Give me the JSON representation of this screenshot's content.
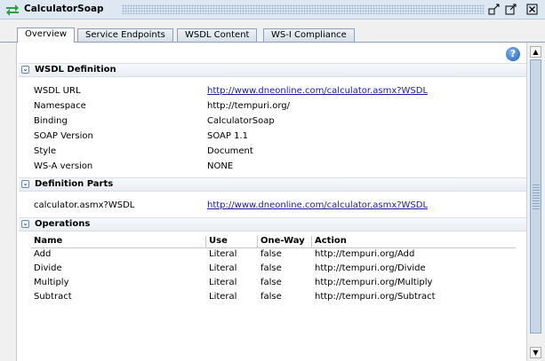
{
  "window": {
    "title": "CalculatorSoap"
  },
  "tabs": [
    "Overview",
    "Service Endpoints",
    "WSDL Content",
    "WS-I Compliance"
  ],
  "help_icon": "?",
  "sections": {
    "wsdl_definition": {
      "title": "WSDL Definition",
      "rows": [
        {
          "label": "WSDL URL",
          "value": "http://www.dneonline.com/calculator.asmx?WSDL"
        },
        {
          "label": "Namespace",
          "value": "http://tempuri.org/"
        },
        {
          "label": "Binding",
          "value": "CalculatorSoap"
        },
        {
          "label": "SOAP Version",
          "value": "SOAP 1.1"
        },
        {
          "label": "Style",
          "value": "Document"
        },
        {
          "label": "WS-A version",
          "value": "NONE"
        }
      ]
    },
    "definition_parts": {
      "title": "Definition Parts",
      "rows": [
        {
          "label": "calculator.asmx?WSDL",
          "value": "http://www.dneonline.com/calculator.asmx?WSDL"
        }
      ]
    },
    "operations": {
      "title": "Operations",
      "columns": [
        "Name",
        "Use",
        "One-Way",
        "Action"
      ],
      "rows": [
        {
          "name": "Add",
          "use": "Literal",
          "oneway": "false",
          "action": "http://tempuri.org/Add"
        },
        {
          "name": "Divide",
          "use": "Literal",
          "oneway": "false",
          "action": "http://tempuri.org/Divide"
        },
        {
          "name": "Multiply",
          "use": "Literal",
          "oneway": "false",
          "action": "http://tempuri.org/Multiply"
        },
        {
          "name": "Subtract",
          "use": "Literal",
          "oneway": "false",
          "action": "http://tempuri.org/Subtract"
        }
      ]
    }
  },
  "colors": {
    "link": "#1a1aa6",
    "titlebar": "#dde8f3",
    "accent": "#1f5fbf"
  }
}
